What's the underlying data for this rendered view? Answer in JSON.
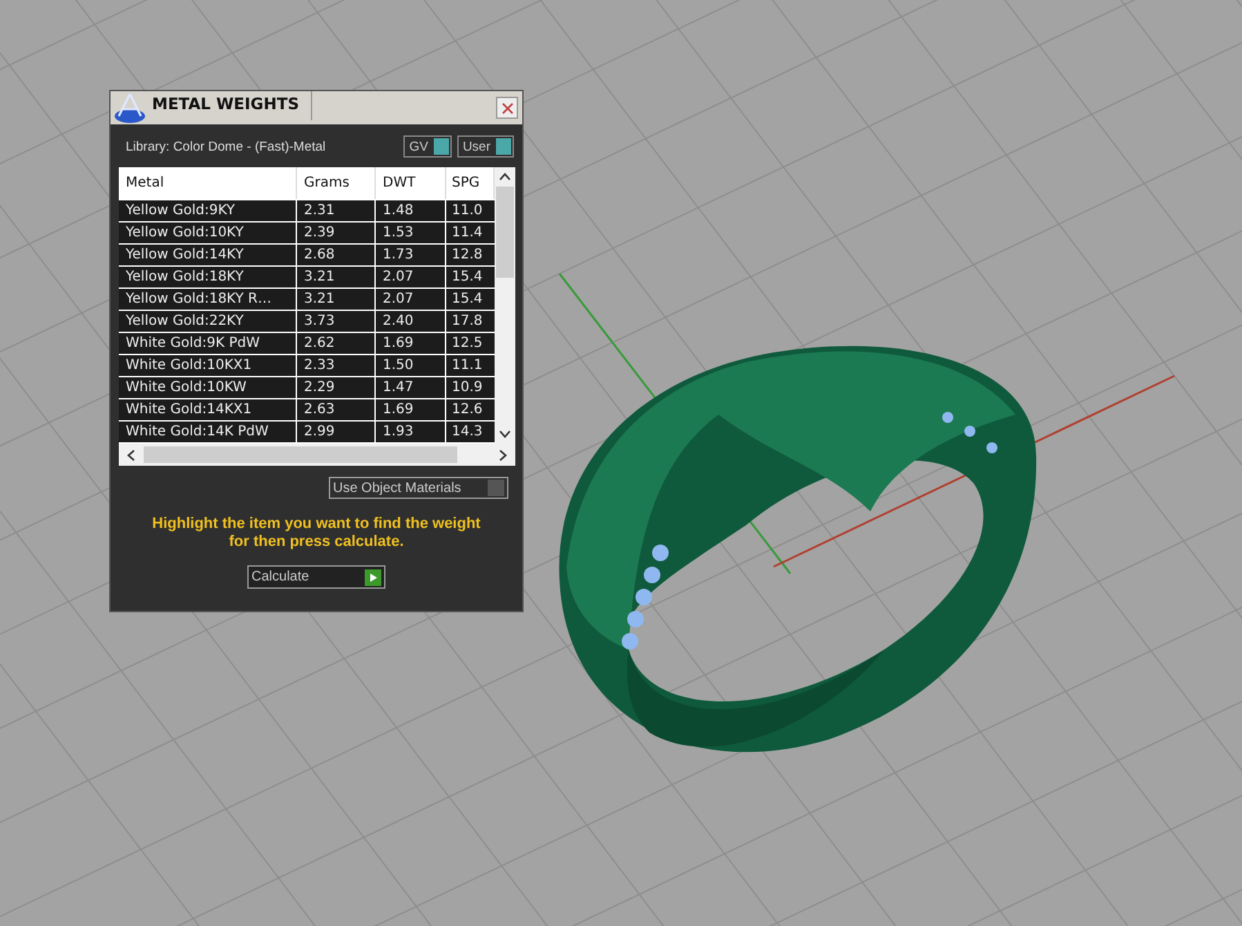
{
  "dialog": {
    "title": "METAL WEIGHTS",
    "library": "Library: Color Dome - (Fast)-Metal",
    "toggles": [
      {
        "label": "GV",
        "on": true
      },
      {
        "label": "User",
        "on": true
      }
    ],
    "table": {
      "columns": [
        "Metal",
        "Grams",
        "DWT",
        "SPG"
      ],
      "rows": [
        {
          "cells": [
            "Yellow Gold:9KY",
            "2.31",
            "1.48",
            "11.0"
          ]
        },
        {
          "cells": [
            "Yellow Gold:10KY",
            "2.39",
            "1.53",
            "11.4"
          ]
        },
        {
          "cells": [
            "Yellow Gold:14KY",
            "2.68",
            "1.73",
            "12.8"
          ]
        },
        {
          "cells": [
            "Yellow Gold:18KY",
            "3.21",
            "2.07",
            "15.4"
          ]
        },
        {
          "cells": [
            "Yellow Gold:18KY R…",
            "3.21",
            "2.07",
            "15.4"
          ]
        },
        {
          "cells": [
            "Yellow Gold:22KY",
            "3.73",
            "2.40",
            "17.8"
          ]
        },
        {
          "cells": [
            "White Gold:9K PdW",
            "2.62",
            "1.69",
            "12.5"
          ]
        },
        {
          "cells": [
            "White Gold:10KX1",
            "2.33",
            "1.50",
            "11.1"
          ]
        },
        {
          "cells": [
            "White Gold:10KW",
            "2.29",
            "1.47",
            "10.9"
          ]
        },
        {
          "cells": [
            "White Gold:14KX1",
            "2.63",
            "1.69",
            "12.6"
          ]
        },
        {
          "cells": [
            "White Gold:14K PdW",
            "2.99",
            "1.93",
            "14.3"
          ]
        }
      ]
    },
    "use_object_materials": {
      "label": "Use Object Materials",
      "checked": false
    },
    "hint": "Highlight the item you want to find the weight for then press calculate.",
    "calculate_button": "Calculate"
  }
}
